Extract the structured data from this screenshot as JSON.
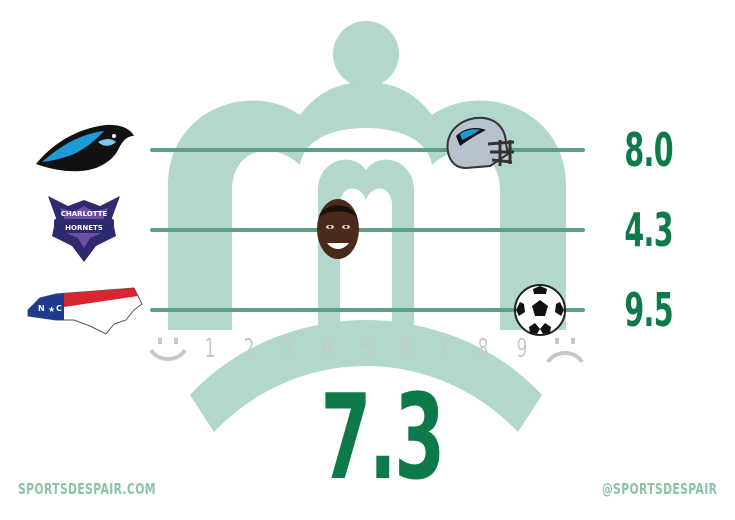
{
  "colors": {
    "accent": "#0e7a4a",
    "crown": "#b2d7cc",
    "track": "#5e9e86",
    "scale": "#c6c9c8",
    "footer": "#8bc3a8"
  },
  "rows": [
    {
      "logo": "carolina-panthers-logo",
      "marker": "football-helmet-icon",
      "score": "8.0",
      "level": 8.0
    },
    {
      "logo": "charlotte-hornets-logo",
      "marker": "player-face-icon",
      "score": "4.3",
      "level": 4.3,
      "logo_text": "HORNETS",
      "logo_subtext": "CHARLOTTE"
    },
    {
      "logo": "north-carolina-flag-map",
      "marker": "soccer-ball-icon",
      "score": "9.5",
      "level": 9.5
    }
  ],
  "scale": {
    "numbers": [
      "1",
      "2",
      "3",
      "4",
      "5",
      "6",
      "7",
      "8",
      "9"
    ],
    "low_face": "happy-face-icon",
    "high_face": "sad-face-icon"
  },
  "total_score": "7.3",
  "footer": {
    "website": "SPORTSDESPAIR.COM",
    "handle": "@SPORTSDESPAIR"
  }
}
